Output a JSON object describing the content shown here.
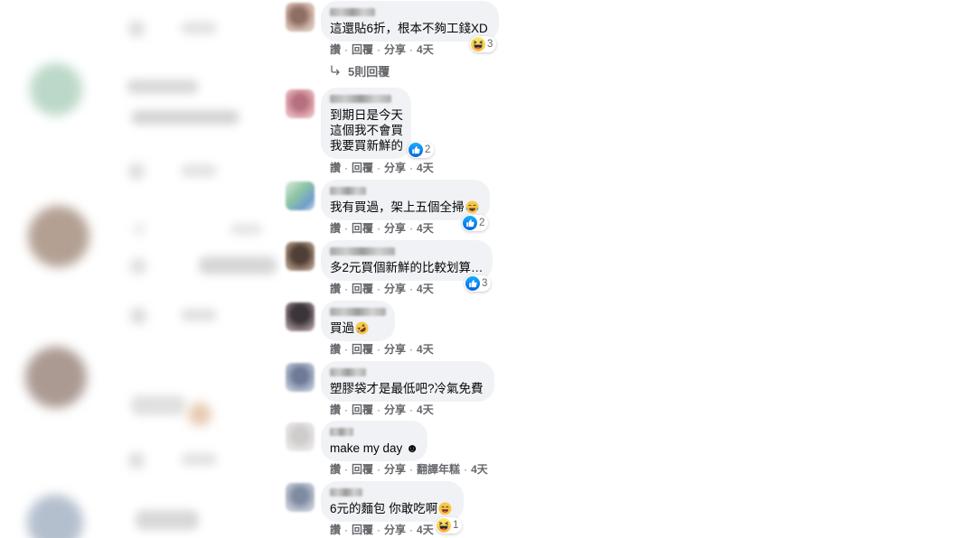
{
  "separator": "·",
  "colors": {
    "bubble": "#f0f2f5",
    "text": "#050505",
    "secondary": "#65676b",
    "like_blue": "#1877f2",
    "haha_yellow": "#f7c84a"
  },
  "comments": [
    {
      "text": [
        "這還貼6折，根本不夠工錢XD"
      ],
      "reaction": {
        "icon": "haha-reaction-icon",
        "count": 3
      },
      "actions": {
        "like": "讚",
        "reply": "回覆",
        "share": "分享",
        "time": "4天"
      },
      "replies_link": "5則回覆"
    },
    {
      "text": [
        "到期日是今天",
        "這個我不會買",
        "我要買新鮮的"
      ],
      "reaction": {
        "icon": "like-reaction-icon",
        "count": 2
      },
      "actions": {
        "like": "讚",
        "reply": "回覆",
        "share": "分享",
        "time": "4天"
      }
    },
    {
      "text": [
        "我有買過，架上五個全掃"
      ],
      "text_emoji": "tears-of-joy-emoji-icon",
      "reaction": {
        "icon": "like-reaction-icon",
        "count": 2
      },
      "actions": {
        "like": "讚",
        "reply": "回覆",
        "share": "分享",
        "time": "4天"
      }
    },
    {
      "text": [
        "多2元買個新鮮的比較划算…"
      ],
      "reaction": {
        "icon": "like-reaction-icon",
        "count": 3
      },
      "actions": {
        "like": "讚",
        "reply": "回覆",
        "share": "分享",
        "time": "4天"
      }
    },
    {
      "text": [
        "買過"
      ],
      "text_emoji": "rolling-on-floor-laughing-emoji-icon",
      "actions": {
        "like": "讚",
        "reply": "回覆",
        "share": "分享",
        "time": "4天"
      }
    },
    {
      "text": [
        "塑膠袋才是最低吧?冷氣免費"
      ],
      "actions": {
        "like": "讚",
        "reply": "回覆",
        "share": "分享",
        "time": "4天"
      }
    },
    {
      "text": [
        "make my day ☻"
      ],
      "actions": {
        "like": "讚",
        "reply": "回覆",
        "share": "分享",
        "translate": "翻譯年糕",
        "time": "4天"
      }
    },
    {
      "text": [
        "6元的麵包 你敢吃啊"
      ],
      "text_emoji": "grinning-smiling-eyes-emoji-icon",
      "reaction": {
        "icon": "haha-reaction-icon",
        "count": 1
      },
      "actions": {
        "like": "讚",
        "reply": "回覆",
        "share": "分享",
        "time": "4天"
      }
    }
  ]
}
